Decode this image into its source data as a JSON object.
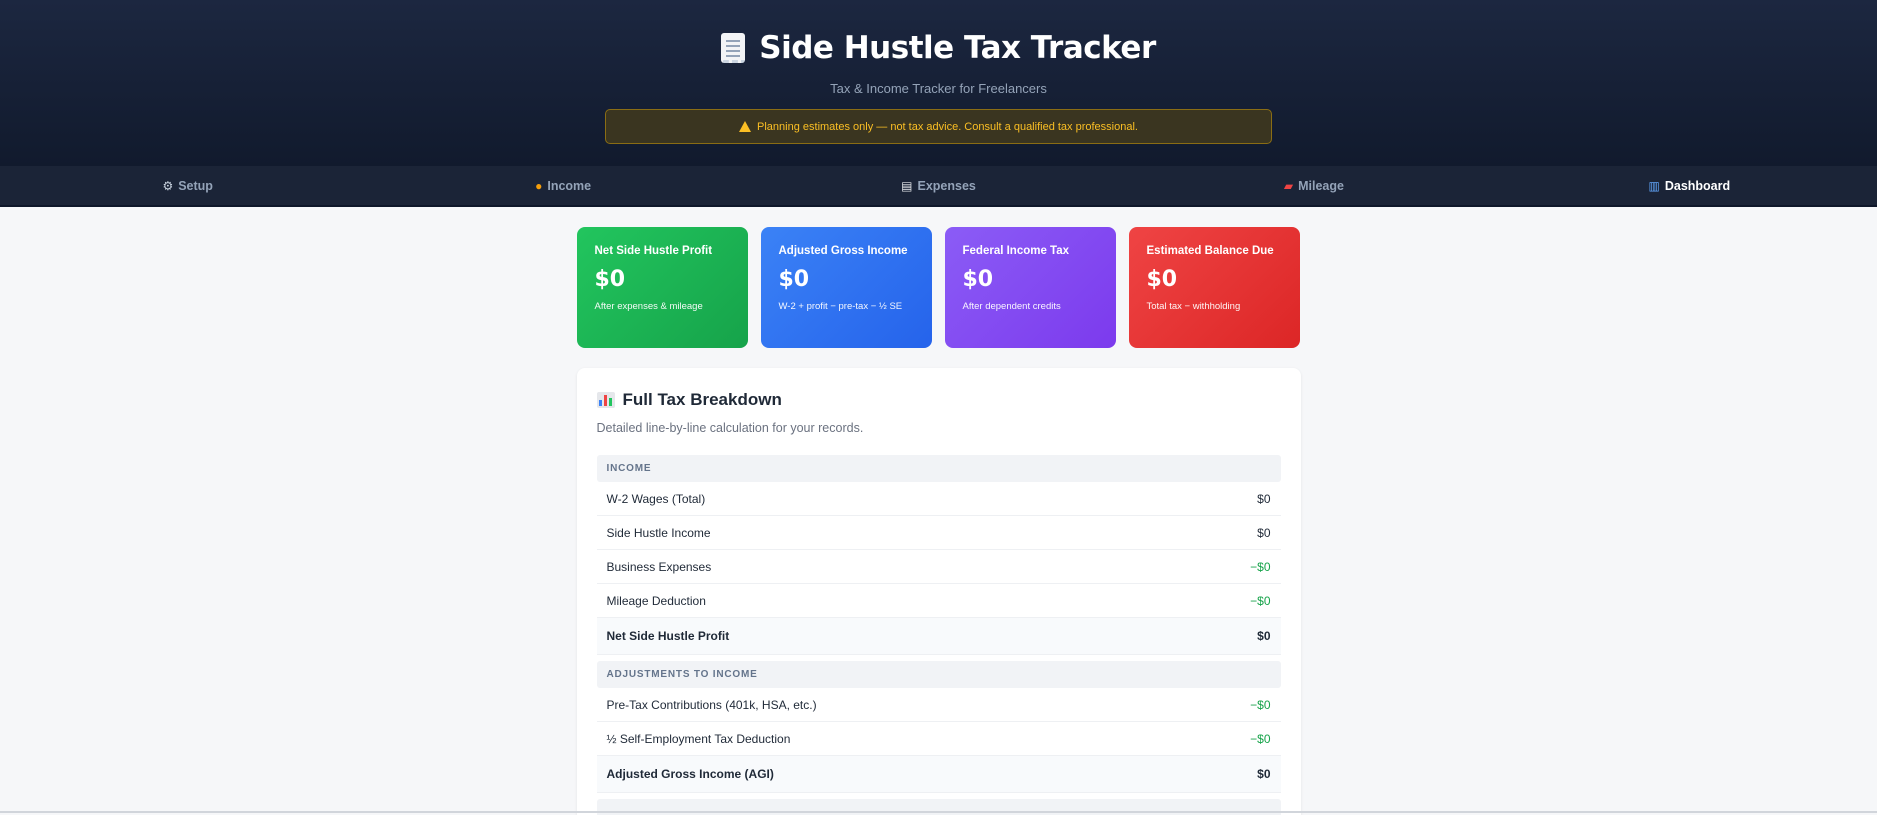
{
  "header": {
    "title": "Side Hustle Tax Tracker",
    "subtitle": "Tax & Income Tracker for Freelancers",
    "disclaimer": "Planning estimates only — not tax advice. Consult a qualified tax professional."
  },
  "nav": {
    "items": [
      {
        "label": "Setup",
        "icon": "gear-icon"
      },
      {
        "label": "Income",
        "icon": "money-bag-icon"
      },
      {
        "label": "Expenses",
        "icon": "receipt-icon"
      },
      {
        "label": "Mileage",
        "icon": "car-icon"
      },
      {
        "label": "Dashboard",
        "icon": "bar-chart-icon",
        "active": true
      }
    ]
  },
  "cards": [
    {
      "label": "Net Side Hustle Profit",
      "value": "$0",
      "note": "After expenses & mileage",
      "color": "#22c55e"
    },
    {
      "label": "Adjusted Gross Income",
      "value": "$0",
      "note": "W-2 + profit − pre-tax − ½ SE",
      "color": "#3b82f6"
    },
    {
      "label": "Federal Income Tax",
      "value": "$0",
      "note": "After dependent credits",
      "color": "#8b5cf6"
    },
    {
      "label": "Estimated Balance Due",
      "value": "$0",
      "note": "Total tax − withholding",
      "color": "#ef4444"
    }
  ],
  "breakdown": {
    "title": "Full Tax Breakdown",
    "description": "Detailed line-by-line calculation for your records.",
    "sections": [
      {
        "heading": "INCOME",
        "rows": [
          {
            "label": "W-2 Wages (Total)",
            "value": "$0"
          },
          {
            "label": "Side Hustle Income",
            "value": "$0"
          },
          {
            "label": "Business Expenses",
            "value": "−$0"
          },
          {
            "label": "Mileage Deduction",
            "value": "−$0"
          },
          {
            "label": "Net Side Hustle Profit",
            "value": "$0"
          }
        ]
      },
      {
        "heading": "ADJUSTMENTS TO INCOME",
        "rows": [
          {
            "label": "Pre-Tax Contributions (401k, HSA, etc.)",
            "value": "−$0"
          },
          {
            "label": "½ Self-Employment Tax Deduction",
            "value": "−$0"
          },
          {
            "label": "Adjusted Gross Income (AGI)",
            "value": "$0"
          }
        ]
      }
    ]
  }
}
